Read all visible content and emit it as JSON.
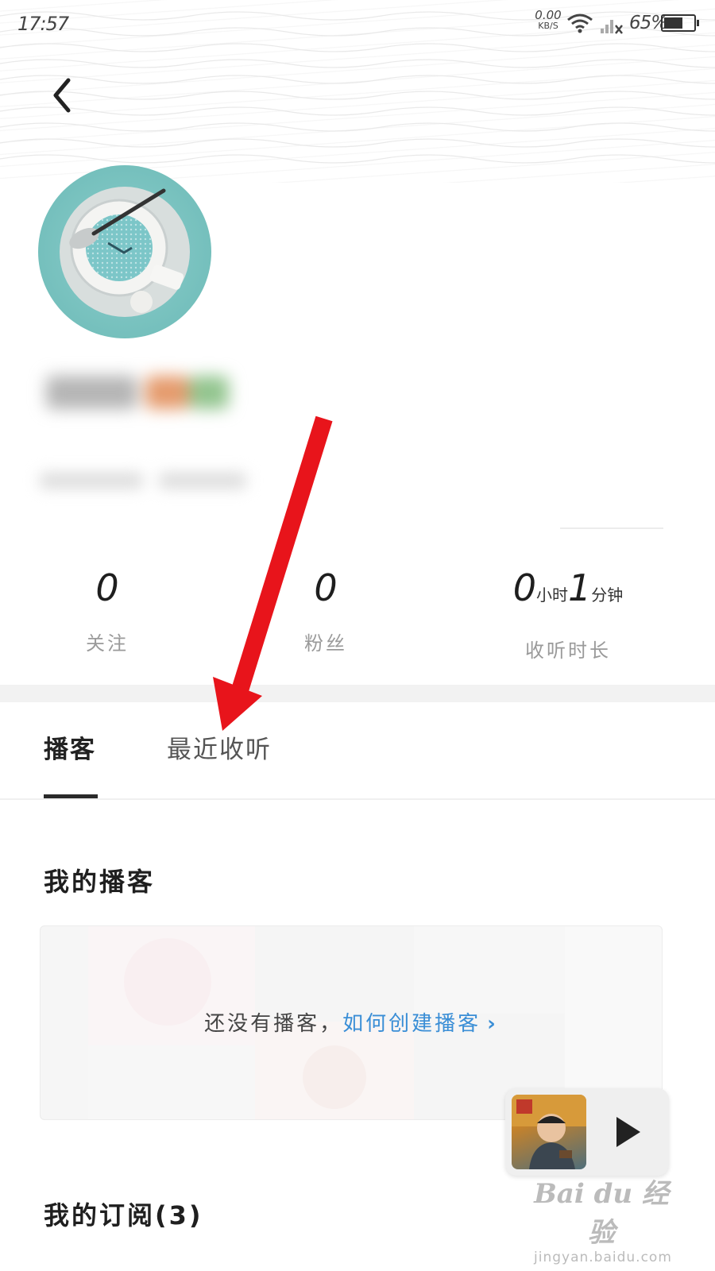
{
  "status_bar": {
    "time": "17:57",
    "net_speed_value": "0.00",
    "net_speed_unit": "KB/S",
    "battery_percent": "65%",
    "battery_level": 0.65
  },
  "header": {
    "back_icon": "chevron-left-icon"
  },
  "stats": [
    {
      "value": "0",
      "label": "关注"
    },
    {
      "value": "0",
      "label": "粉丝"
    },
    {
      "hours": "0",
      "hours_unit": "小时",
      "minutes": "1",
      "minutes_unit": "分钟",
      "label": "收听时长"
    }
  ],
  "tabs": [
    {
      "label": "播客",
      "active": true
    },
    {
      "label": "最近收听",
      "active": false
    }
  ],
  "my_podcasts": {
    "title": "我的播客",
    "empty_text": "还没有播客，",
    "create_link": "如何创建播客",
    "chevron": "›"
  },
  "subscriptions": {
    "title": "我的订阅(3)"
  },
  "mini_player": {
    "play_icon": "play-icon"
  },
  "watermark": {
    "brand": "Bai du 经验",
    "url": "jingyan.baidu.com"
  },
  "colors": {
    "link": "#3a8ed6",
    "arrow": "#e8141b",
    "avatar_ring": "#6bb9b6"
  }
}
